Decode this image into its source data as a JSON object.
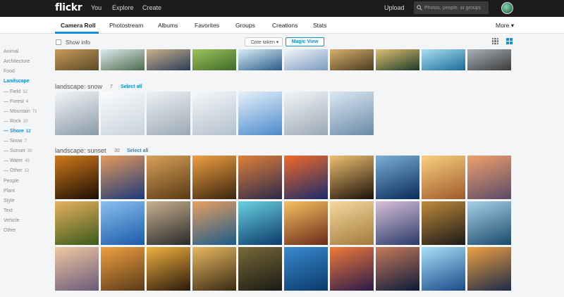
{
  "topbar": {
    "logo": "flickr",
    "nav": [
      "You",
      "Explore",
      "Create"
    ],
    "upload": "Upload",
    "search_placeholder": "Photos, people, or groups"
  },
  "subnav": {
    "tabs": [
      "Camera Roll",
      "Photostream",
      "Albums",
      "Favorites",
      "Groups",
      "Creations",
      "Stats"
    ],
    "more": "More ▾"
  },
  "toolbar": {
    "show_info": "Show info",
    "sort": "Date taken ▾",
    "magic_view": "Magic View"
  },
  "sidebar": {
    "items": [
      {
        "label": "Animal",
        "count": ""
      },
      {
        "label": "Architecture",
        "count": ""
      },
      {
        "label": "Food",
        "count": ""
      },
      {
        "label": "Landscape",
        "count": ""
      },
      {
        "label": "— Field",
        "count": "32"
      },
      {
        "label": "— Forest",
        "count": "4"
      },
      {
        "label": "— Mountain",
        "count": "71"
      },
      {
        "label": "— Rock",
        "count": "20"
      },
      {
        "label": "— Shore",
        "count": "12"
      },
      {
        "label": "— Snow",
        "count": "7"
      },
      {
        "label": "— Sunset",
        "count": "30"
      },
      {
        "label": "— Water",
        "count": "45"
      },
      {
        "label": "— Other",
        "count": "12"
      },
      {
        "label": "People",
        "count": ""
      },
      {
        "label": "Plant",
        "count": ""
      },
      {
        "label": "Style",
        "count": ""
      },
      {
        "label": "Text",
        "count": ""
      },
      {
        "label": "Vehicle",
        "count": ""
      },
      {
        "label": "Other",
        "count": ""
      }
    ]
  },
  "sections": [
    {
      "title": "landscape: snow",
      "count": "7",
      "select_all": "Select all"
    },
    {
      "title": "landscape: sunset",
      "count": "30",
      "select_all": "Select all"
    }
  ],
  "photos": {
    "top_row": [
      [
        "#5a4a2a",
        "#c89a58"
      ],
      [
        "#4b6b4a",
        "#dfe9ef"
      ],
      [
        "#2b3a5a",
        "#c9b28a"
      ],
      [
        "#3f6a2a",
        "#9cc25a"
      ],
      [
        "#2a5a8a",
        "#d9eef5"
      ],
      [
        "#7a9ac0",
        "#f2f5f8"
      ],
      [
        "#4a3a22",
        "#d8b06a"
      ],
      [
        "#1a3a2a",
        "#e0c070"
      ],
      [
        "#1a6a9a",
        "#a9dff0"
      ],
      [
        "#3a3a3a",
        "#a9b2b8"
      ]
    ],
    "snow_row": [
      [
        "#8a9aa8",
        "#f4f6f8"
      ],
      [
        "#c8d2dc",
        "#fbfcfd"
      ],
      [
        "#9aa8b4",
        "#eef2f5"
      ],
      [
        "#b2c0cc",
        "#f6f8fa"
      ],
      [
        "#4a8acc",
        "#e8f2fa"
      ],
      [
        "#9aa8b4",
        "#f3f6f8"
      ],
      [
        "#6a8aa8",
        "#dce8f2"
      ]
    ],
    "sunset_rows": [
      [
        [
          "#1a0e04",
          "#d27a1a"
        ],
        [
          "#1a3a7a",
          "#e69a5a"
        ],
        [
          "#5a3a14",
          "#d8a05a"
        ],
        [
          "#3a2410",
          "#f0a040"
        ],
        [
          "#2a2a4a",
          "#e0803a"
        ],
        [
          "#1a2a6a",
          "#f06a2a"
        ],
        [
          "#1a1008",
          "#f0c070"
        ],
        [
          "#0a2a5a",
          "#7ab0d8"
        ],
        [
          "#a05a2a",
          "#f8d080"
        ],
        [
          "#5a4a6a",
          "#f0a06a"
        ]
      ],
      [
        [
          "#3a5a1a",
          "#e8b060"
        ],
        [
          "#1a5aa8",
          "#8ac0f0"
        ],
        [
          "#2a2a2a",
          "#c8b090"
        ],
        [
          "#1a5a8a",
          "#e8a060"
        ],
        [
          "#0a3a6a",
          "#6ad0e0"
        ],
        [
          "#6a2a1a",
          "#f8c060"
        ],
        [
          "#a07a3a",
          "#f8d8a0"
        ],
        [
          "#2a3a6a",
          "#d8c0d8"
        ],
        [
          "#1a1a1a",
          "#c08a3a"
        ],
        [
          "#1a4a6a",
          "#a8d0e8"
        ]
      ],
      [
        [
          "#6a5a7a",
          "#f0c8a0"
        ],
        [
          "#5a3a1a",
          "#f0a040"
        ],
        [
          "#2a1a0a",
          "#f0b040"
        ],
        [
          "#3a2a14",
          "#e8b860"
        ],
        [
          "#1a1a14",
          "#7a6a3a"
        ],
        [
          "#0a3a6a",
          "#3a8ad0"
        ],
        [
          "#2a1a4a",
          "#f07a3a"
        ],
        [
          "#0a1a3a",
          "#c87a5a"
        ],
        [
          "#1a4a8a",
          "#a8e0f8"
        ],
        [
          "#1a2a4a",
          "#f0a040"
        ]
      ]
    ]
  }
}
